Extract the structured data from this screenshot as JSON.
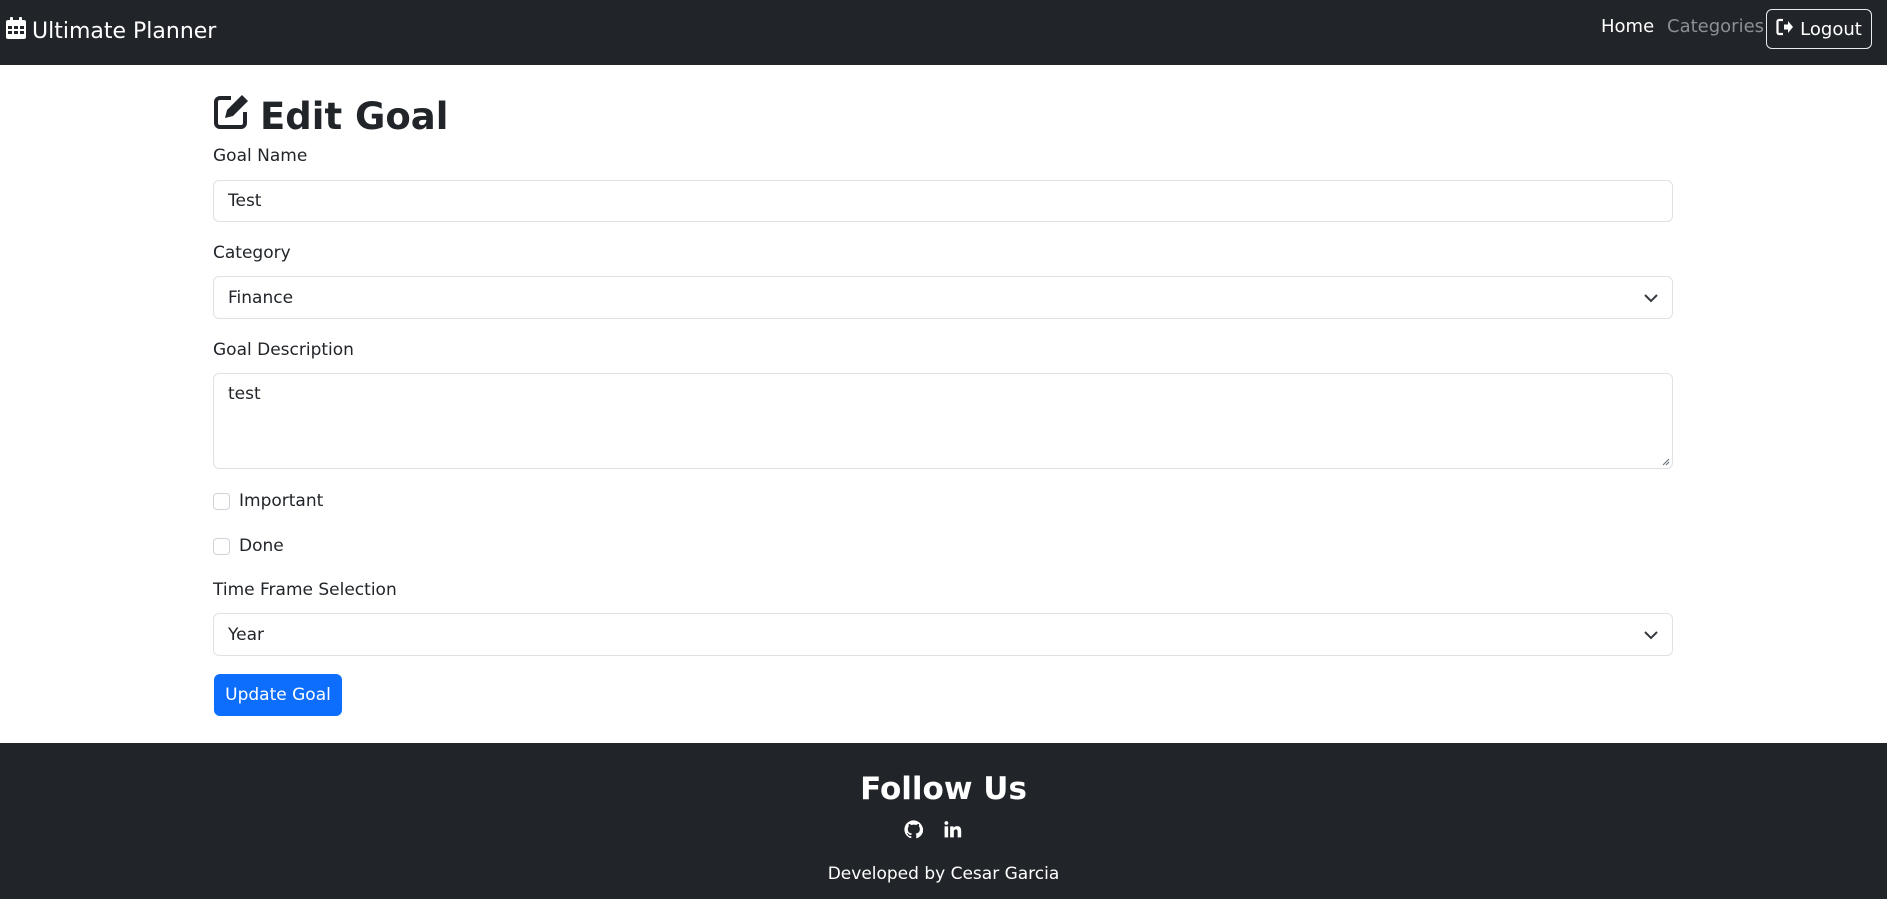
{
  "navbar": {
    "brand": "Ultimate Planner",
    "home_link": "Home",
    "categories_link": "Categories",
    "logout_label": "Logout"
  },
  "form": {
    "title": "Edit Goal",
    "goal_name_label": "Goal Name",
    "goal_name_value": "Test",
    "category_label": "Category",
    "category_value": "Finance",
    "description_label": "Goal Description",
    "description_value": "test",
    "important_label": "Important",
    "important_checked": false,
    "done_label": "Done",
    "done_checked": false,
    "timeframe_label": "Time Frame Selection",
    "timeframe_value": "Year",
    "submit_label": "Update Goal"
  },
  "footer": {
    "title": "Follow Us",
    "social_icons": [
      "github-icon",
      "linkedin-icon"
    ],
    "credit": "Developed by Cesar Garcia"
  },
  "colors": {
    "navbar_bg": "#212529",
    "primary": "#0d6efd",
    "muted_link": "#8c8f93"
  }
}
